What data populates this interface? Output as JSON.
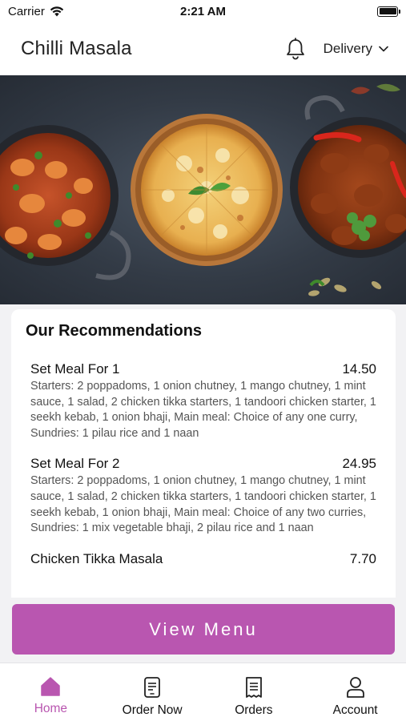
{
  "status_bar": {
    "carrier": "Carrier",
    "time": "2:21 AM"
  },
  "header": {
    "title": "Chilli Masala",
    "delivery_label": "Delivery"
  },
  "recommendations": {
    "title": "Our Recommendations",
    "items": [
      {
        "name": "Set Meal For 1",
        "price": "14.50",
        "description": "Starters: 2 poppadoms, 1 onion chutney, 1 mango chutney, 1 mint sauce, 1 salad, 2 chicken tikka starters, 1 tandoori chicken starter, 1 seekh kebab, 1 onion bhaji, Main meal: Choice of any one curry, Sundries: 1 pilau rice and 1 naan"
      },
      {
        "name": "Set Meal For 2",
        "price": "24.95",
        "description": "Starters: 2 poppadoms, 1 onion chutney, 1 mango chutney, 1 mint sauce, 1 salad, 2 chicken tikka starters, 1 tandoori chicken starter, 1 seekh kebab, 1 onion bhaji, Main meal: Choice of any two curries, Sundries: 1 mix vegetable bhaji, 2 pilau rice and 1 naan"
      },
      {
        "name": "Chicken Tikka Masala",
        "price": "7.70",
        "description": ""
      }
    ]
  },
  "view_menu_label": "View Menu",
  "tabs": [
    {
      "label": "Home",
      "icon": "home-icon",
      "active": true
    },
    {
      "label": "Order Now",
      "icon": "order-now-icon",
      "active": false
    },
    {
      "label": "Orders",
      "icon": "orders-icon",
      "active": false
    },
    {
      "label": "Account",
      "icon": "account-icon",
      "active": false
    }
  ],
  "colors": {
    "accent": "#b956b0",
    "hero_bg": "#3a424d"
  }
}
